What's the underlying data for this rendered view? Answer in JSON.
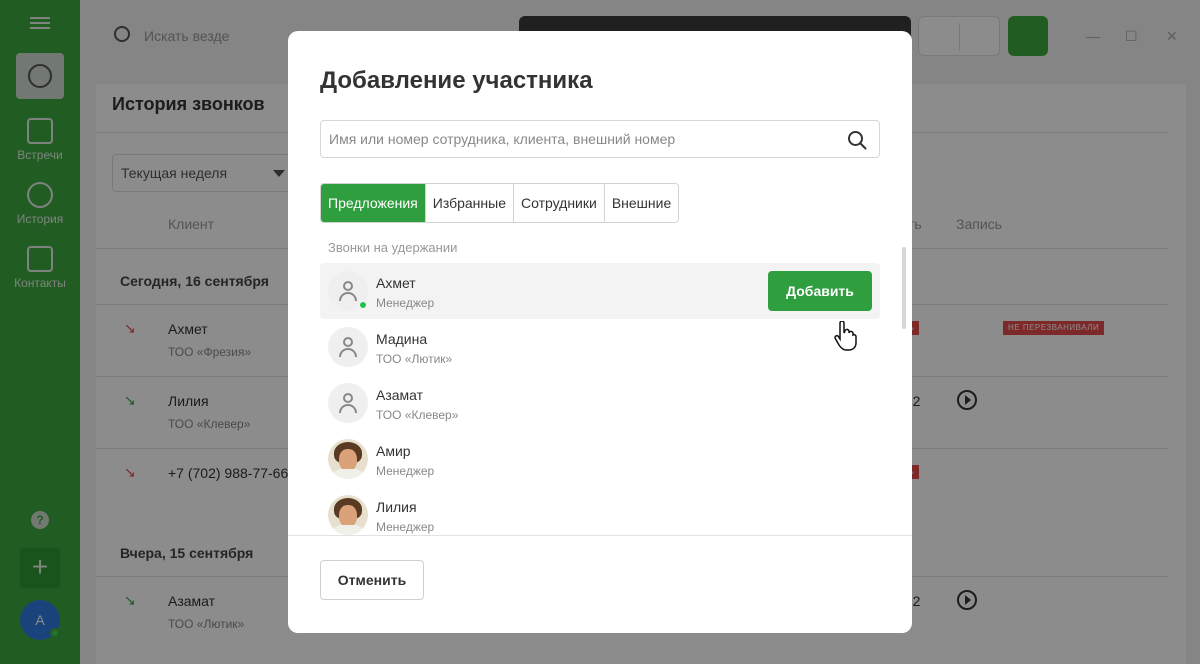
{
  "sidebar": {
    "items": [
      {
        "label": "Встречи",
        "icon": "contact-card-icon"
      },
      {
        "label": "История",
        "icon": "clock-icon"
      },
      {
        "label": "Контакты",
        "icon": "contact-card-icon"
      }
    ],
    "help_label": "?",
    "add_label": "+",
    "avatar_initial": "А"
  },
  "background": {
    "search_placeholder": "Искать везде",
    "page_title": "История звонков",
    "period_select": "Текущая неделя",
    "columns": {
      "client": "Клиент",
      "duration_fragment": "сть",
      "record": "Запись"
    },
    "groups": [
      {
        "day": "Сегодня, 16 сентября",
        "rows": [
          {
            "name": "Ахмет",
            "sub": "ТОО «Фрезия»",
            "type": "missed",
            "badge_fragment": "сть",
            "badge": "НЕ ПЕРЕЗВАНИВАЛИ"
          },
          {
            "name": "Лилия",
            "sub": "ТОО «Клевер»",
            "type": "incoming",
            "duration_fragment": ":32"
          },
          {
            "name": "+7 (702) 988-77-66",
            "sub": "",
            "type": "missed",
            "badge_fragment": "сть"
          }
        ]
      },
      {
        "day": "Вчера, 15 сентября",
        "rows": [
          {
            "name": "Азамат",
            "sub": "ТОО «Лютик»",
            "type": "incoming",
            "duration_fragment": ":12"
          }
        ]
      }
    ],
    "window_controls": [
      "—",
      "☐",
      "✕"
    ]
  },
  "modal": {
    "title": "Добавление участника",
    "search_placeholder": "Имя или номер сотрудника, клиента, внешний номер",
    "search_value": "",
    "tabs": [
      {
        "label": "Предложения",
        "active": true
      },
      {
        "label": "Избранные",
        "active": false
      },
      {
        "label": "Сотрудники",
        "active": false
      },
      {
        "label": "Внешние",
        "active": false
      }
    ],
    "section_label": "Звонки на удержании",
    "contacts": [
      {
        "name": "Ахмет",
        "sub": "Менеджер",
        "avatar": "placeholder",
        "online": true,
        "highlighted": true
      },
      {
        "name": "Мадина",
        "sub": "ТОО «Лютик»",
        "avatar": "placeholder",
        "online": false,
        "highlighted": false
      },
      {
        "name": "Азамат",
        "sub": "ТОО «Клевер»",
        "avatar": "placeholder",
        "online": false,
        "highlighted": false
      },
      {
        "name": "Амир",
        "sub": "Менеджер",
        "avatar": "photo",
        "online": false,
        "highlighted": false
      },
      {
        "name": "Лилия",
        "sub": "Менеджер",
        "avatar": "photo",
        "online": false,
        "highlighted": false
      }
    ],
    "add_button": "Добавить",
    "cancel_button": "Отменить"
  },
  "colors": {
    "brand_green": "#3da83f",
    "button_green": "#2f9e3f",
    "missed_red": "#e34b4b",
    "online_green": "#22c34b"
  }
}
